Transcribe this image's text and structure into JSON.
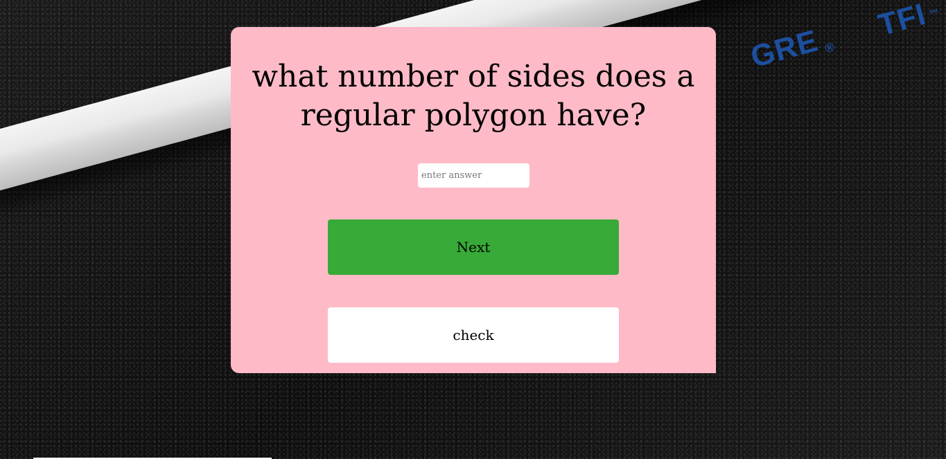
{
  "background": {
    "stick": {
      "brand": "GRE",
      "registered": "®",
      "model": "TFI",
      "trademark": "™"
    }
  },
  "quiz": {
    "question": "what number of sides does a regular polygon have?",
    "input": {
      "placeholder": "enter answer",
      "value": ""
    },
    "next_label": "Next",
    "check_label": "check"
  },
  "colors": {
    "card_background": "#ffbac7",
    "next_button": "#37aa37",
    "check_button": "#ffffff",
    "brand_text": "#1d4f9f"
  }
}
